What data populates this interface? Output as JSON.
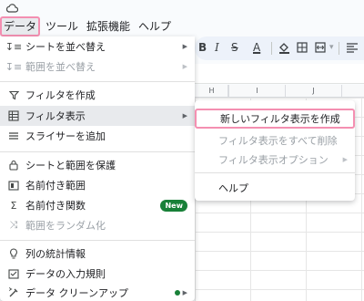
{
  "menubar": {
    "items": [
      "データ",
      "ツール",
      "拡張機能",
      "ヘルプ"
    ],
    "active_index": 0
  },
  "toolbar": {
    "column_labels": [
      "H",
      "I",
      "J"
    ]
  },
  "data_menu": {
    "items": [
      {
        "label": "シートを並べ替え",
        "icon": "sort-icon",
        "has_submenu": true,
        "disabled": false
      },
      {
        "label": "範囲を並べ替え",
        "icon": "sort-range-icon",
        "has_submenu": true,
        "disabled": true
      },
      {
        "label": "フィルタを作成",
        "icon": "filter-icon",
        "has_submenu": false,
        "disabled": false
      },
      {
        "label": "フィルタ表示",
        "icon": "filter-view-icon",
        "has_submenu": true,
        "disabled": false,
        "highlighted": true
      },
      {
        "label": "スライサーを追加",
        "icon": "slicer-icon",
        "has_submenu": false,
        "disabled": false
      },
      {
        "label": "シートと範囲を保護",
        "icon": "lock-icon",
        "has_submenu": false,
        "disabled": false
      },
      {
        "label": "名前付き範囲",
        "icon": "named-range-icon",
        "has_submenu": false,
        "disabled": false
      },
      {
        "label": "名前付き関数",
        "icon": "sigma-icon",
        "has_submenu": false,
        "disabled": false,
        "badge": "New"
      },
      {
        "label": "範囲をランダム化",
        "icon": "shuffle-icon",
        "has_submenu": false,
        "disabled": true
      },
      {
        "label": "列の統計情報",
        "icon": "lightbulb-icon",
        "has_submenu": false,
        "disabled": false
      },
      {
        "label": "データの入力規則",
        "icon": "validation-icon",
        "has_submenu": false,
        "disabled": false
      },
      {
        "label": "データ クリーンアップ",
        "icon": "cleanup-icon",
        "has_submenu": true,
        "disabled": false,
        "dot": true
      }
    ]
  },
  "submenu": {
    "items": [
      {
        "label": "新しいフィルタ表示を作成",
        "disabled": false,
        "outlined": true
      },
      {
        "label": "フィルタ表示をすべて削除",
        "disabled": true
      },
      {
        "label": "フィルタ表示オプション",
        "disabled": true,
        "has_submenu": true
      },
      {
        "label": "ヘルプ",
        "disabled": false
      }
    ]
  },
  "colors": {
    "accent_outline": "#f48fb1",
    "badge_green": "#188038",
    "highlight": "#e8eaed"
  }
}
